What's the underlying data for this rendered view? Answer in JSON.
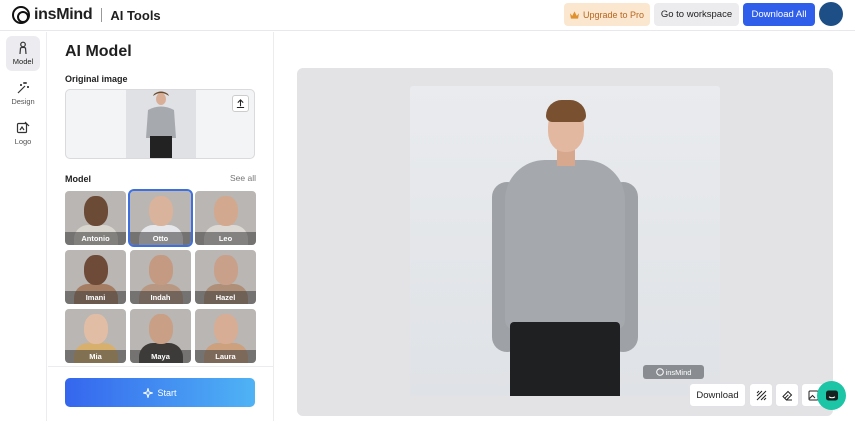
{
  "header": {
    "brand": "insMind",
    "section": "AI Tools",
    "upgrade_label": "Upgrade to Pro",
    "workspace_label": "Go to workspace",
    "download_all_label": "Download All"
  },
  "rail": {
    "items": [
      {
        "label": "Model",
        "icon": "person-icon"
      },
      {
        "label": "Design",
        "icon": "magic-wand-icon"
      },
      {
        "label": "Logo",
        "icon": "logo-edit-icon"
      }
    ]
  },
  "panel": {
    "title": "AI Model",
    "original_label": "Original image",
    "model_label": "Model",
    "see_all": "See all",
    "start_label": "Start",
    "models": [
      {
        "name": "Antonio",
        "skin": "#6b4a36",
        "shirt": "#d9d5cf"
      },
      {
        "name": "Otto",
        "skin": "#d9b39b",
        "shirt": "#e6e7ea"
      },
      {
        "name": "Leo",
        "skin": "#d2a98e",
        "shirt": "#dcd8d3"
      },
      {
        "name": "Imani",
        "skin": "#6e4a38",
        "shirt": "#a57d62"
      },
      {
        "name": "Indah",
        "skin": "#c49a82",
        "shirt": "#b99883"
      },
      {
        "name": "Hazel",
        "skin": "#c9a18a",
        "shirt": "#b08f79"
      },
      {
        "name": "Mia",
        "skin": "#e1bda5",
        "shirt": "#d8b06e"
      },
      {
        "name": "Maya",
        "skin": "#c99f86",
        "shirt": "#3e3a38"
      },
      {
        "name": "Laura",
        "skin": "#d7ad95",
        "shirt": "#cda07e"
      }
    ],
    "selected_model": "Otto"
  },
  "preview": {
    "watermark": "insMind"
  },
  "toolbar": {
    "download_label": "Download",
    "tools": [
      "pattern-icon",
      "eraser-icon",
      "image-icon"
    ]
  },
  "colors": {
    "accent": "#2f5fea",
    "pro_bg": "#fbe7cf",
    "pro_text": "#b8661f",
    "chat": "#1bc5a5"
  }
}
